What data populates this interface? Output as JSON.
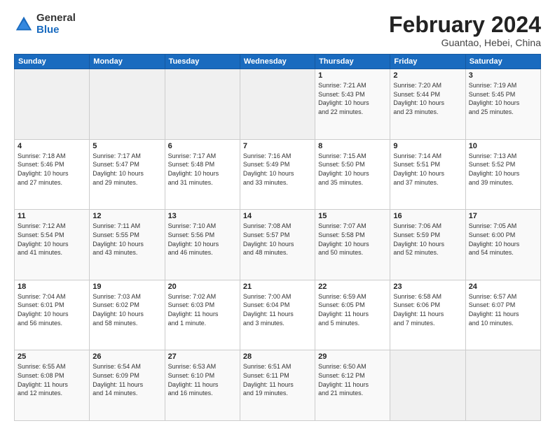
{
  "logo": {
    "general": "General",
    "blue": "Blue"
  },
  "header": {
    "title": "February 2024",
    "subtitle": "Guantao, Hebei, China"
  },
  "weekdays": [
    "Sunday",
    "Monday",
    "Tuesday",
    "Wednesday",
    "Thursday",
    "Friday",
    "Saturday"
  ],
  "weeks": [
    [
      {
        "day": "",
        "info": ""
      },
      {
        "day": "",
        "info": ""
      },
      {
        "day": "",
        "info": ""
      },
      {
        "day": "",
        "info": ""
      },
      {
        "day": "1",
        "info": "Sunrise: 7:21 AM\nSunset: 5:43 PM\nDaylight: 10 hours\nand 22 minutes."
      },
      {
        "day": "2",
        "info": "Sunrise: 7:20 AM\nSunset: 5:44 PM\nDaylight: 10 hours\nand 23 minutes."
      },
      {
        "day": "3",
        "info": "Sunrise: 7:19 AM\nSunset: 5:45 PM\nDaylight: 10 hours\nand 25 minutes."
      }
    ],
    [
      {
        "day": "4",
        "info": "Sunrise: 7:18 AM\nSunset: 5:46 PM\nDaylight: 10 hours\nand 27 minutes."
      },
      {
        "day": "5",
        "info": "Sunrise: 7:17 AM\nSunset: 5:47 PM\nDaylight: 10 hours\nand 29 minutes."
      },
      {
        "day": "6",
        "info": "Sunrise: 7:17 AM\nSunset: 5:48 PM\nDaylight: 10 hours\nand 31 minutes."
      },
      {
        "day": "7",
        "info": "Sunrise: 7:16 AM\nSunset: 5:49 PM\nDaylight: 10 hours\nand 33 minutes."
      },
      {
        "day": "8",
        "info": "Sunrise: 7:15 AM\nSunset: 5:50 PM\nDaylight: 10 hours\nand 35 minutes."
      },
      {
        "day": "9",
        "info": "Sunrise: 7:14 AM\nSunset: 5:51 PM\nDaylight: 10 hours\nand 37 minutes."
      },
      {
        "day": "10",
        "info": "Sunrise: 7:13 AM\nSunset: 5:52 PM\nDaylight: 10 hours\nand 39 minutes."
      }
    ],
    [
      {
        "day": "11",
        "info": "Sunrise: 7:12 AM\nSunset: 5:54 PM\nDaylight: 10 hours\nand 41 minutes."
      },
      {
        "day": "12",
        "info": "Sunrise: 7:11 AM\nSunset: 5:55 PM\nDaylight: 10 hours\nand 43 minutes."
      },
      {
        "day": "13",
        "info": "Sunrise: 7:10 AM\nSunset: 5:56 PM\nDaylight: 10 hours\nand 46 minutes."
      },
      {
        "day": "14",
        "info": "Sunrise: 7:08 AM\nSunset: 5:57 PM\nDaylight: 10 hours\nand 48 minutes."
      },
      {
        "day": "15",
        "info": "Sunrise: 7:07 AM\nSunset: 5:58 PM\nDaylight: 10 hours\nand 50 minutes."
      },
      {
        "day": "16",
        "info": "Sunrise: 7:06 AM\nSunset: 5:59 PM\nDaylight: 10 hours\nand 52 minutes."
      },
      {
        "day": "17",
        "info": "Sunrise: 7:05 AM\nSunset: 6:00 PM\nDaylight: 10 hours\nand 54 minutes."
      }
    ],
    [
      {
        "day": "18",
        "info": "Sunrise: 7:04 AM\nSunset: 6:01 PM\nDaylight: 10 hours\nand 56 minutes."
      },
      {
        "day": "19",
        "info": "Sunrise: 7:03 AM\nSunset: 6:02 PM\nDaylight: 10 hours\nand 58 minutes."
      },
      {
        "day": "20",
        "info": "Sunrise: 7:02 AM\nSunset: 6:03 PM\nDaylight: 11 hours\nand 1 minute."
      },
      {
        "day": "21",
        "info": "Sunrise: 7:00 AM\nSunset: 6:04 PM\nDaylight: 11 hours\nand 3 minutes."
      },
      {
        "day": "22",
        "info": "Sunrise: 6:59 AM\nSunset: 6:05 PM\nDaylight: 11 hours\nand 5 minutes."
      },
      {
        "day": "23",
        "info": "Sunrise: 6:58 AM\nSunset: 6:06 PM\nDaylight: 11 hours\nand 7 minutes."
      },
      {
        "day": "24",
        "info": "Sunrise: 6:57 AM\nSunset: 6:07 PM\nDaylight: 11 hours\nand 10 minutes."
      }
    ],
    [
      {
        "day": "25",
        "info": "Sunrise: 6:55 AM\nSunset: 6:08 PM\nDaylight: 11 hours\nand 12 minutes."
      },
      {
        "day": "26",
        "info": "Sunrise: 6:54 AM\nSunset: 6:09 PM\nDaylight: 11 hours\nand 14 minutes."
      },
      {
        "day": "27",
        "info": "Sunrise: 6:53 AM\nSunset: 6:10 PM\nDaylight: 11 hours\nand 16 minutes."
      },
      {
        "day": "28",
        "info": "Sunrise: 6:51 AM\nSunset: 6:11 PM\nDaylight: 11 hours\nand 19 minutes."
      },
      {
        "day": "29",
        "info": "Sunrise: 6:50 AM\nSunset: 6:12 PM\nDaylight: 11 hours\nand 21 minutes."
      },
      {
        "day": "",
        "info": ""
      },
      {
        "day": "",
        "info": ""
      }
    ]
  ]
}
